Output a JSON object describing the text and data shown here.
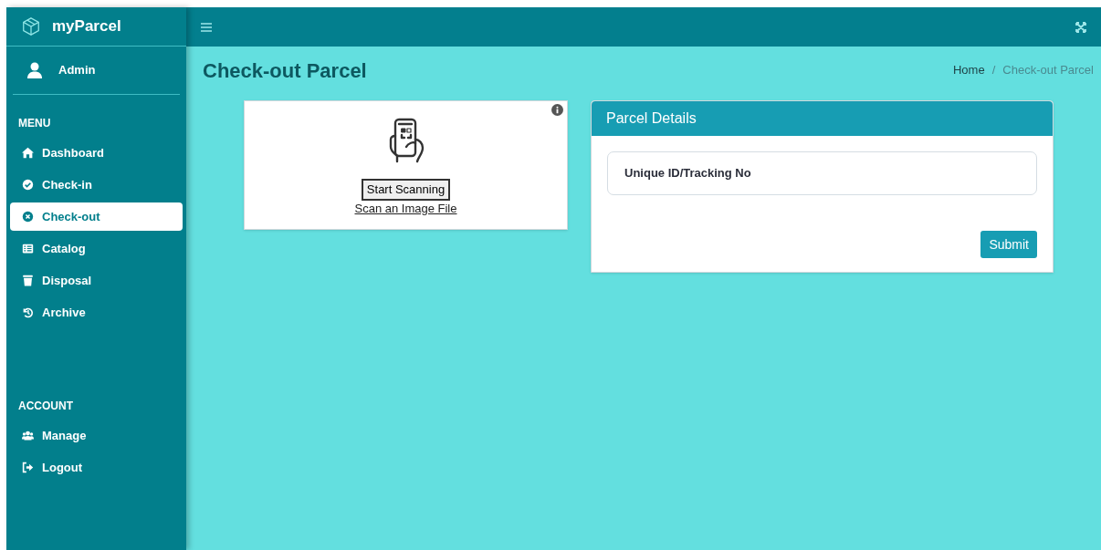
{
  "brand": {
    "name": "myParcel"
  },
  "user": {
    "name": "Admin"
  },
  "sidebar": {
    "sections": [
      {
        "title": "MENU",
        "items": [
          {
            "label": "Dashboard",
            "kind": "home",
            "selected": false
          },
          {
            "label": "Check-in",
            "kind": "check",
            "selected": false
          },
          {
            "label": "Check-out",
            "kind": "cross",
            "selected": true
          },
          {
            "label": "Catalog",
            "kind": "list",
            "selected": false
          },
          {
            "label": "Disposal",
            "kind": "trash",
            "selected": false
          },
          {
            "label": "Archive",
            "kind": "history",
            "selected": false
          }
        ]
      },
      {
        "title": "ACCOUNT",
        "items": [
          {
            "label": "Manage",
            "kind": "users",
            "selected": false
          },
          {
            "label": "Logout",
            "kind": "logout",
            "selected": false
          }
        ]
      }
    ]
  },
  "page": {
    "title": "Check-out Parcel",
    "breadcrumb": [
      "Home",
      "Check-out Parcel"
    ],
    "breadcrumb_separator": "/"
  },
  "scanner": {
    "button": "Start Scanning",
    "link": "Scan an Image File"
  },
  "details": {
    "title": "Parcel Details",
    "field_label": "Unique ID/Tracking No",
    "submit": "Submit"
  }
}
